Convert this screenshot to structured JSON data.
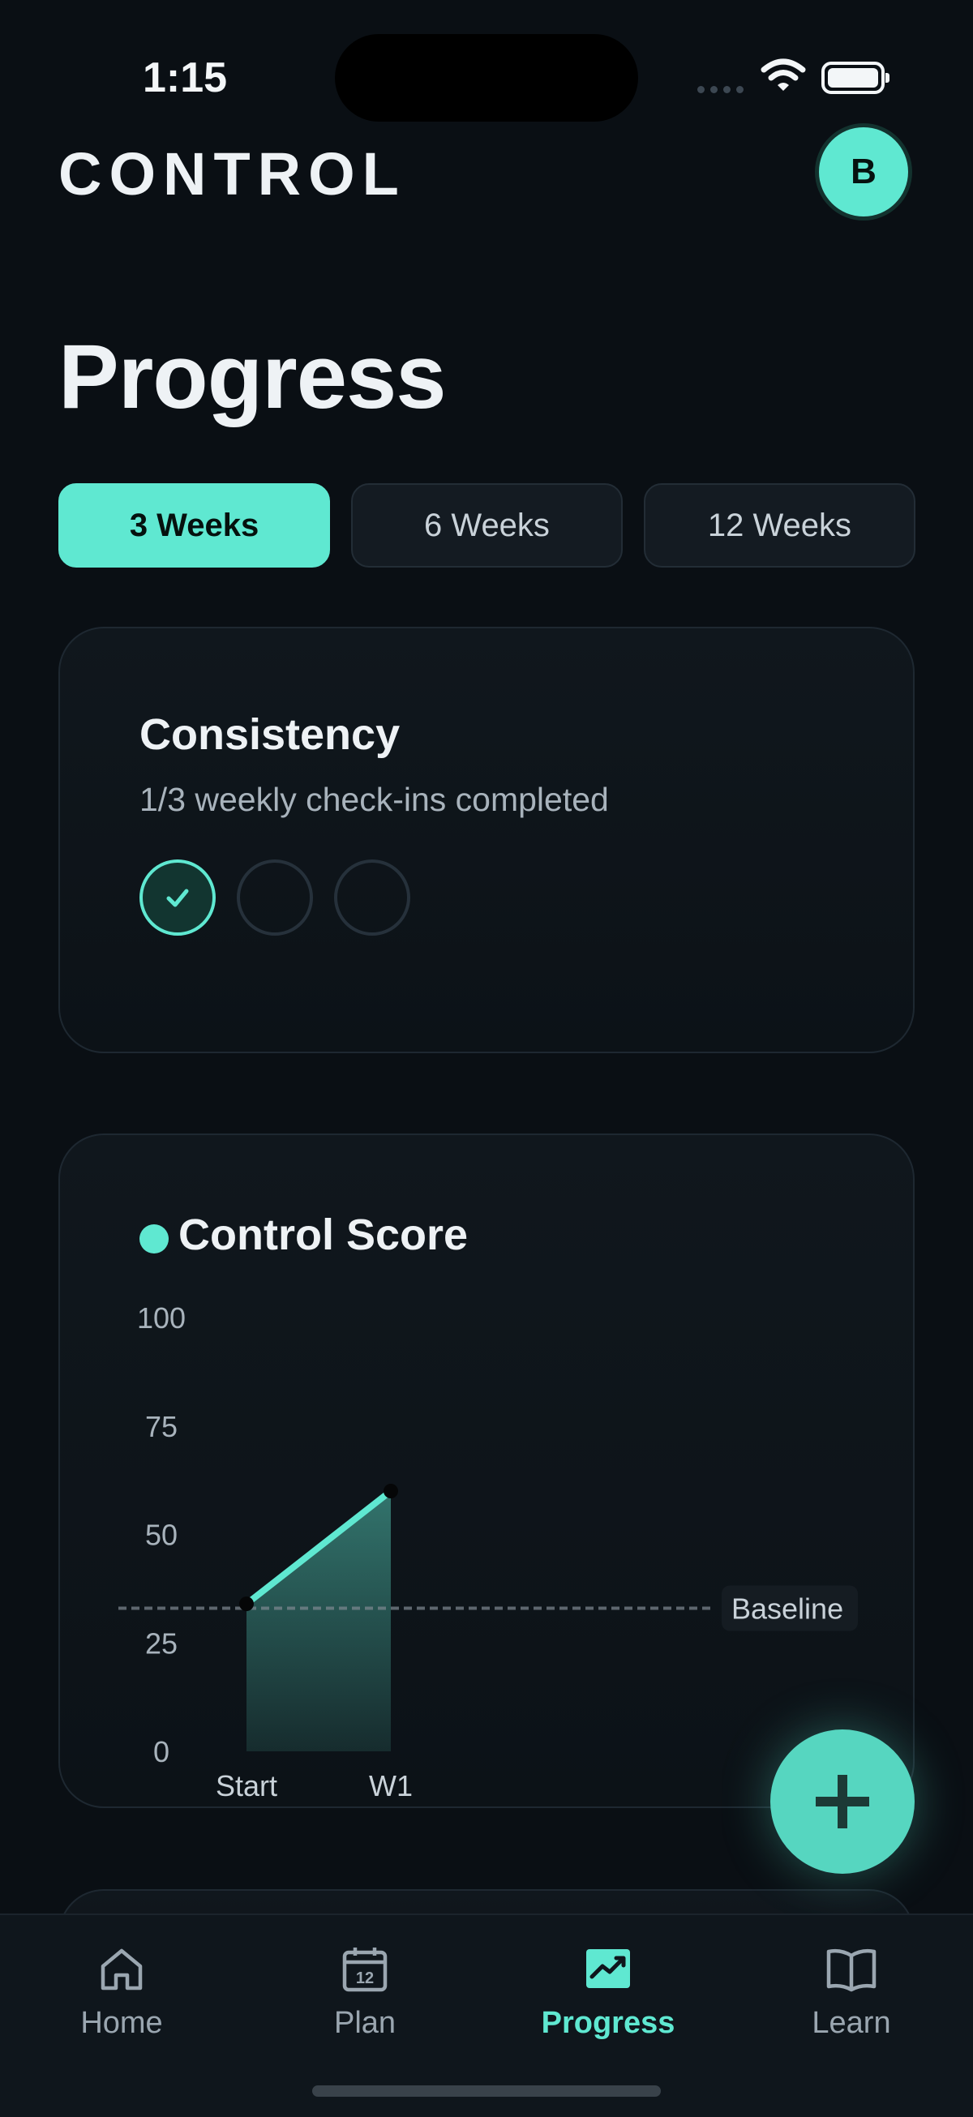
{
  "status_bar": {
    "time": "1:15"
  },
  "header": {
    "brand": "CONTROL",
    "avatar_initial": "B"
  },
  "page": {
    "title": "Progress"
  },
  "tabs": [
    {
      "label": "3 Weeks",
      "active": true
    },
    {
      "label": "6 Weeks",
      "active": false
    },
    {
      "label": "12 Weeks",
      "active": false
    }
  ],
  "consistency": {
    "title": "Consistency",
    "subtitle": "1/3 weekly check-ins completed",
    "checkins": [
      true,
      false,
      false
    ]
  },
  "score_card": {
    "title": "Control Score",
    "accent": "#5fe8d1"
  },
  "chart_data": {
    "type": "area",
    "title": "Control Score",
    "categories": [
      "Start",
      "W1"
    ],
    "values": [
      34,
      60
    ],
    "ylim": [
      0,
      100
    ],
    "yticks": [
      "100",
      "75",
      "50",
      "25",
      "0"
    ],
    "baseline": {
      "label": "Baseline",
      "value": 33
    },
    "grid": false,
    "color": "#5fe8d1"
  },
  "fab": {
    "icon": "plus-icon"
  },
  "nav": [
    {
      "label": "Home",
      "icon": "home-icon",
      "active": false
    },
    {
      "label": "Plan",
      "icon": "calendar-icon",
      "active": false,
      "icon_text": "12"
    },
    {
      "label": "Progress",
      "icon": "chart-icon",
      "active": true
    },
    {
      "label": "Learn",
      "icon": "book-icon",
      "active": false
    }
  ],
  "colors": {
    "accent": "#5fe8d1",
    "background": "#0a0f14"
  }
}
